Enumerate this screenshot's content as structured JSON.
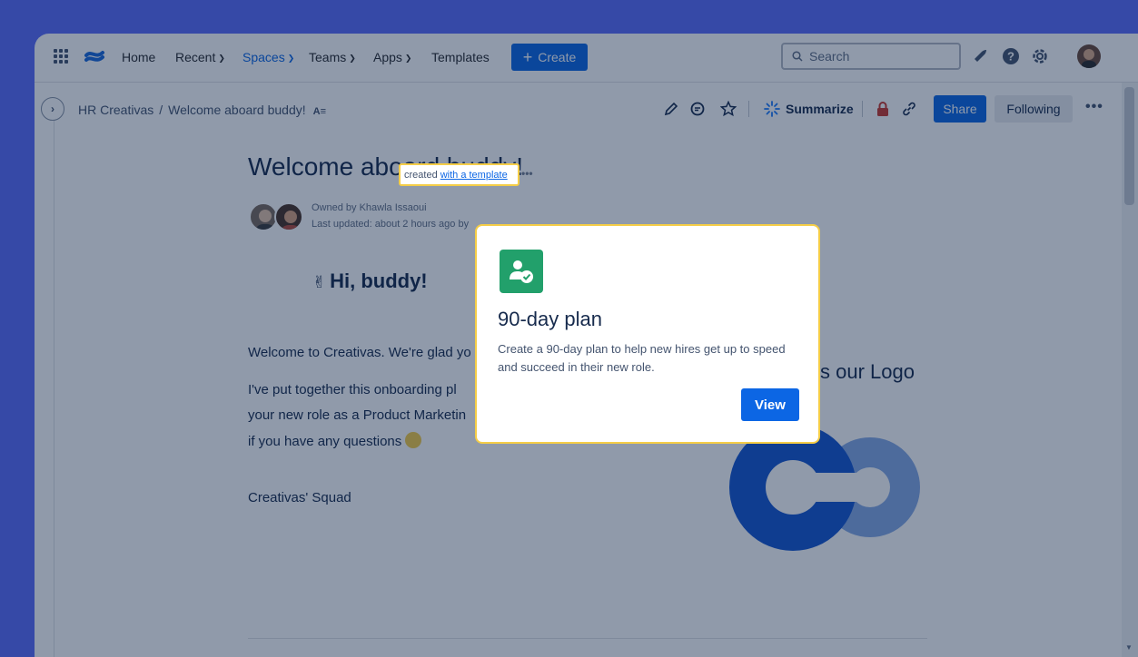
{
  "nav": {
    "items": [
      {
        "label": "Home"
      },
      {
        "label": "Recent"
      },
      {
        "label": "Spaces"
      },
      {
        "label": "Teams"
      },
      {
        "label": "Apps"
      },
      {
        "label": "Templates"
      }
    ],
    "create_label": "Create",
    "search_placeholder": "Search"
  },
  "breadcrumb": {
    "space": "HR Creativas",
    "separator": "/",
    "page": "Welcome aboard buddy!"
  },
  "toolbar": {
    "summarize_label": "Summarize",
    "share_label": "Share",
    "following_label": "Following"
  },
  "page": {
    "title": "Welcome aboard buddy!",
    "owner_text": "Owned by Khawla Issaoui",
    "created_text": "created",
    "template_link": "with a template",
    "updated_text": "Last updated: about 2 hours ago by",
    "greeting": "Hi, buddy!",
    "paragraphs": [
      "Welcome to Creativas. We're glad yo",
      "I've put together this onboarding pl",
      "your new role as a Product Marketin",
      "if you have any questions"
    ],
    "signoff": "Creativas' Squad",
    "logo_heading": "s our Logo"
  },
  "popup": {
    "title": "90-day plan",
    "description": "Create a 90-day plan to help new hires get up to speed and succeed in their new role.",
    "button_label": "View",
    "icon": "person-check-icon"
  },
  "colors": {
    "background": "#5b6cf9",
    "primary": "#0c66e4",
    "highlight_border": "#f5cd47",
    "template_green": "#22a06b"
  }
}
